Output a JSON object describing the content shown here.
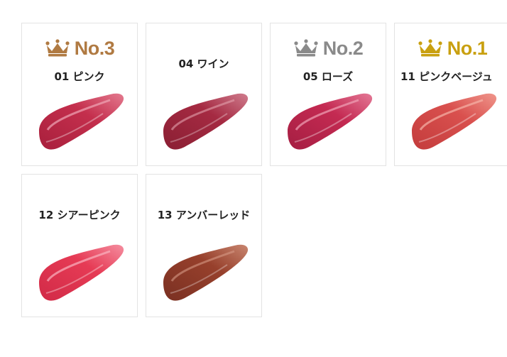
{
  "colors": {
    "bronze": "#b07a42",
    "silver": "#8a8a8a",
    "gold": "#c9a010",
    "border": "#e3e3e3",
    "name_text": "#222222"
  },
  "items": [
    {
      "rank_label": "No.3",
      "rank_tier": "bronze",
      "name": "01 ピンク",
      "swatch_color": "#c42f4d",
      "swatch_highlight": "#f0a7b6"
    },
    {
      "rank_label": "",
      "rank_tier": "",
      "name": "04 ワイン",
      "swatch_color": "#a52a42",
      "swatch_highlight": "#e3a1ad"
    },
    {
      "rank_label": "No.2",
      "rank_tier": "silver",
      "name": "05 ローズ",
      "swatch_color": "#c42a52",
      "swatch_highlight": "#f0a2b6"
    },
    {
      "rank_label": "No.1",
      "rank_tier": "gold",
      "name": "11 ピンクベージュ",
      "swatch_color": "#d9504e",
      "swatch_highlight": "#f5b3a8"
    },
    {
      "rank_label": "",
      "rank_tier": "",
      "name": "12 シアーピンク",
      "swatch_color": "#e63b55",
      "swatch_highlight": "#f9b3c0"
    },
    {
      "rank_label": "",
      "rank_tier": "",
      "name": "13 アンバーレッド",
      "swatch_color": "#97402c",
      "swatch_highlight": "#d59a86"
    }
  ]
}
